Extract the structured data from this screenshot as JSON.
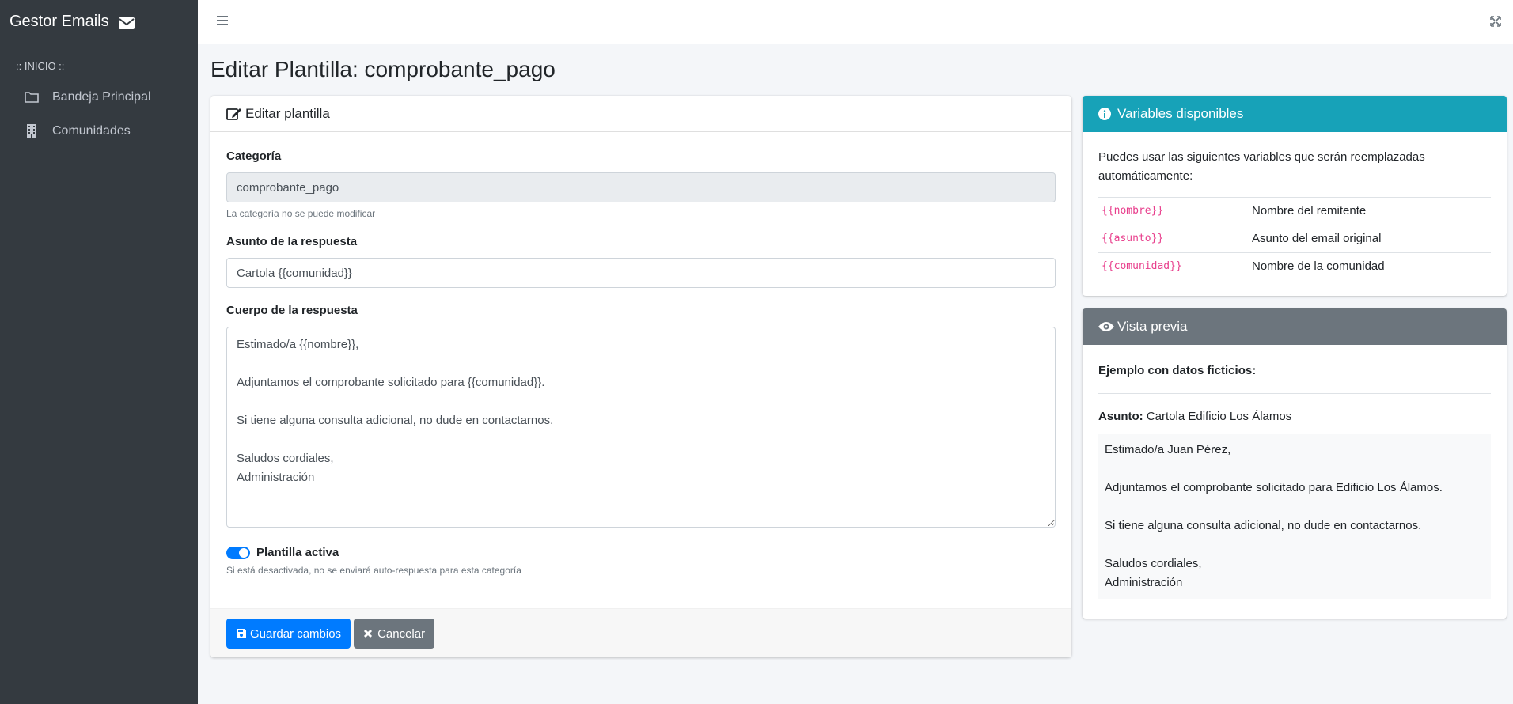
{
  "app": {
    "brand": "Gestor Emails"
  },
  "sidebar": {
    "header": ":: INICIO ::",
    "items": [
      {
        "label": "Bandeja Principal",
        "icon": "folder-icon"
      },
      {
        "label": "Comunidades",
        "icon": "building-icon"
      }
    ]
  },
  "page": {
    "title": "Editar Plantilla: comprobante_pago"
  },
  "edit_card": {
    "header": "Editar plantilla",
    "category_label": "Categoría",
    "category_value": "comprobante_pago",
    "category_help": "La categoría no se puede modificar",
    "subject_label": "Asunto de la respuesta",
    "subject_value": "Cartola {{comunidad}}",
    "body_label": "Cuerpo de la respuesta",
    "body_value": "Estimado/a {{nombre}},\n\nAdjuntamos el comprobante solicitado para {{comunidad}}.\n\nSi tiene alguna consulta adicional, no dude en contactarnos.\n\nSaludos cordiales,\nAdministración",
    "active_label": "Plantilla activa",
    "active": true,
    "active_help": "Si está desactivada, no se enviará auto-respuesta para esta categoría",
    "save_label": "Guardar cambios",
    "cancel_label": "Cancelar"
  },
  "vars_card": {
    "header": "Variables disponibles",
    "intro": "Puedes usar las siguientes variables que serán reemplazadas automáticamente:",
    "rows": [
      {
        "var": "{{nombre}}",
        "desc": "Nombre del remitente"
      },
      {
        "var": "{{asunto}}",
        "desc": "Asunto del email original"
      },
      {
        "var": "{{comunidad}}",
        "desc": "Nombre de la comunidad"
      }
    ]
  },
  "preview_card": {
    "header": "Vista previa",
    "subtitle": "Ejemplo con datos ficticios:",
    "subject_label": "Asunto:",
    "subject_value": "Cartola Edificio Los Álamos",
    "body": "Estimado/a Juan Pérez,\n\nAdjuntamos el comprobante solicitado para Edificio Los Álamos.\n\nSi tiene alguna consulta adicional, no dude en contactarnos.\n\nSaludos cordiales,\nAdministración"
  },
  "colors": {
    "sidebar_bg": "#343a40",
    "primary": "#007bff",
    "info": "#17a2b8",
    "secondary": "#6c757d",
    "code": "#e83e8c"
  }
}
